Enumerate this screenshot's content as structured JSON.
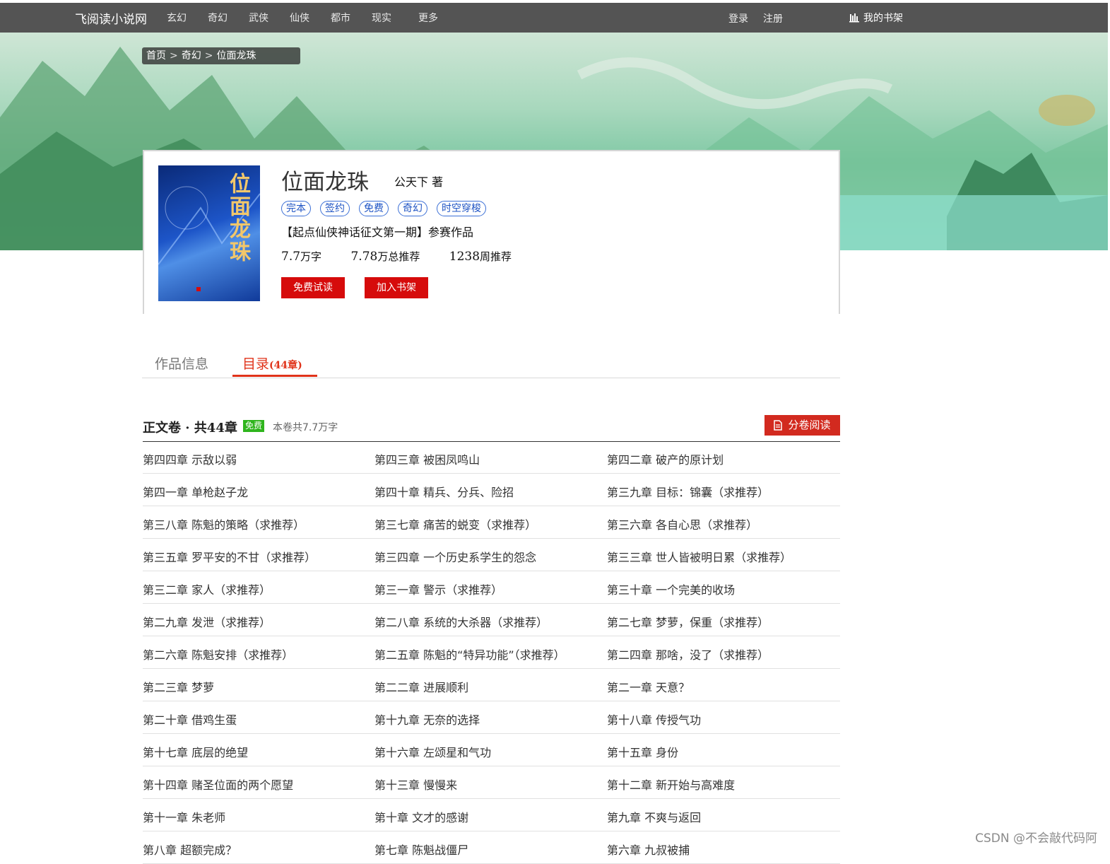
{
  "nav": {
    "logo": "飞阅读小说网",
    "categories": [
      "玄幻",
      "奇幻",
      "武侠",
      "仙侠",
      "都市",
      "现实",
      "更多"
    ],
    "login": "登录",
    "register": "注册",
    "shelf": "我的书架"
  },
  "breadcrumb": [
    "首页",
    "奇幻",
    "位面龙珠"
  ],
  "book": {
    "cover_title": "位面龙珠",
    "title": "位面龙珠",
    "author": "公天下 著",
    "tags": [
      "完本",
      "签约",
      "免费",
      "奇幻",
      "时空穿梭"
    ],
    "intro": "【起点仙侠神话征文第一期】参赛作品",
    "words_num": "7.7",
    "words_unit": "万字",
    "total_rec_num": "7.78",
    "total_rec_unit": "万总推荐",
    "week_rec_num": "1238",
    "week_rec_unit": "周推荐",
    "btn_read": "免费试读",
    "btn_shelf": "加入书架"
  },
  "tabs": {
    "info": "作品信息",
    "toc": "目录",
    "toc_count": "(44章)"
  },
  "volume": {
    "title": "正文卷 · 共44章",
    "free": "免费",
    "words": "本卷共7.7万字",
    "read_btn": "分卷阅读"
  },
  "chapters": [
    "第四四章 示敌以弱",
    "第四三章 被困凤鸣山",
    "第四二章 破产的原计划",
    "第四一章 单枪赵子龙",
    "第四十章 精兵、分兵、险招",
    "第三九章 目标：锦囊（求推荐）",
    "第三八章 陈魁的策略（求推荐）",
    "第三七章 痛苦的蜕变（求推荐）",
    "第三六章 各自心思（求推荐）",
    "第三五章 罗平安的不甘（求推荐）",
    "第三四章 一个历史系学生的怨念",
    "第三三章 世人皆被明日累（求推荐）",
    "第三二章 家人（求推荐）",
    "第三一章 警示（求推荐）",
    "第三十章 一个完美的收场",
    "第二九章 发泄（求推荐）",
    "第二八章 系统的大杀器（求推荐）",
    "第二七章 梦萝，保重（求推荐）",
    "第二六章 陈魁安排（求推荐）",
    "第二五章 陈魁的“特异功能”（求推荐）",
    "第二四章 那啥，没了（求推荐）",
    "第二三章 梦萝",
    "第二二章 进展顺利",
    "第二一章 天意？",
    "第二十章 借鸡生蛋",
    "第十九章 无奈的选择",
    "第十八章 传授气功",
    "第十七章 底层的绝望",
    "第十六章 左颂星和气功",
    "第十五章 身份",
    "第十四章 赌圣位面的两个愿望",
    "第十三章 慢慢来",
    "第十二章 新开始与高难度",
    "第十一章 朱老师",
    "第十章 文才的感谢",
    "第九章 不爽与返回",
    "第八章 超额完成？",
    "第七章 陈魁战僵尸",
    "第六章 九叔被捕"
  ],
  "watermark": "CSDN @不会敲代码阿",
  "colors": {
    "accent_red": "#d60b0b",
    "tag_blue": "#1f54c4",
    "free_green": "#2fb51d",
    "nav_bg": "#545454"
  }
}
